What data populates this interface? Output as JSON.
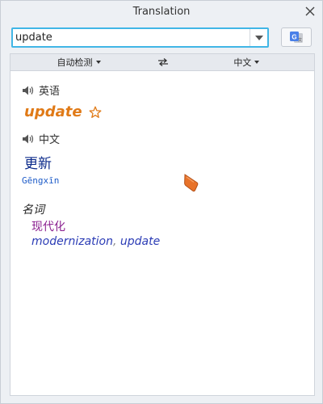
{
  "window": {
    "title": "Translation"
  },
  "search": {
    "value": "update"
  },
  "language_bar": {
    "source": "自动检测",
    "target": "中文"
  },
  "result": {
    "source_lang_label": "英语",
    "headword": "update",
    "target_lang_label": "中文",
    "translation": "更新",
    "pinyin": "Gēngxīn",
    "part_of_speech": "名词",
    "sense_zh": "现代化",
    "sense_en_1": "modernization",
    "sense_en_sep": ",",
    "sense_en_2": "update"
  },
  "colors": {
    "accent_border": "#41b6e6",
    "headword": "#e07a17",
    "translation": "#0b2a8a",
    "sense_zh": "#8a1f8f",
    "sense_en": "#2a3bb5"
  },
  "icons": {
    "close": "close-icon",
    "dropdown": "chevron-down-icon",
    "translate": "google-translate-icon",
    "swap": "swap-icon",
    "speaker": "speaker-icon",
    "star": "star-outline-icon",
    "cursor": "mouse-pointer-icon"
  }
}
